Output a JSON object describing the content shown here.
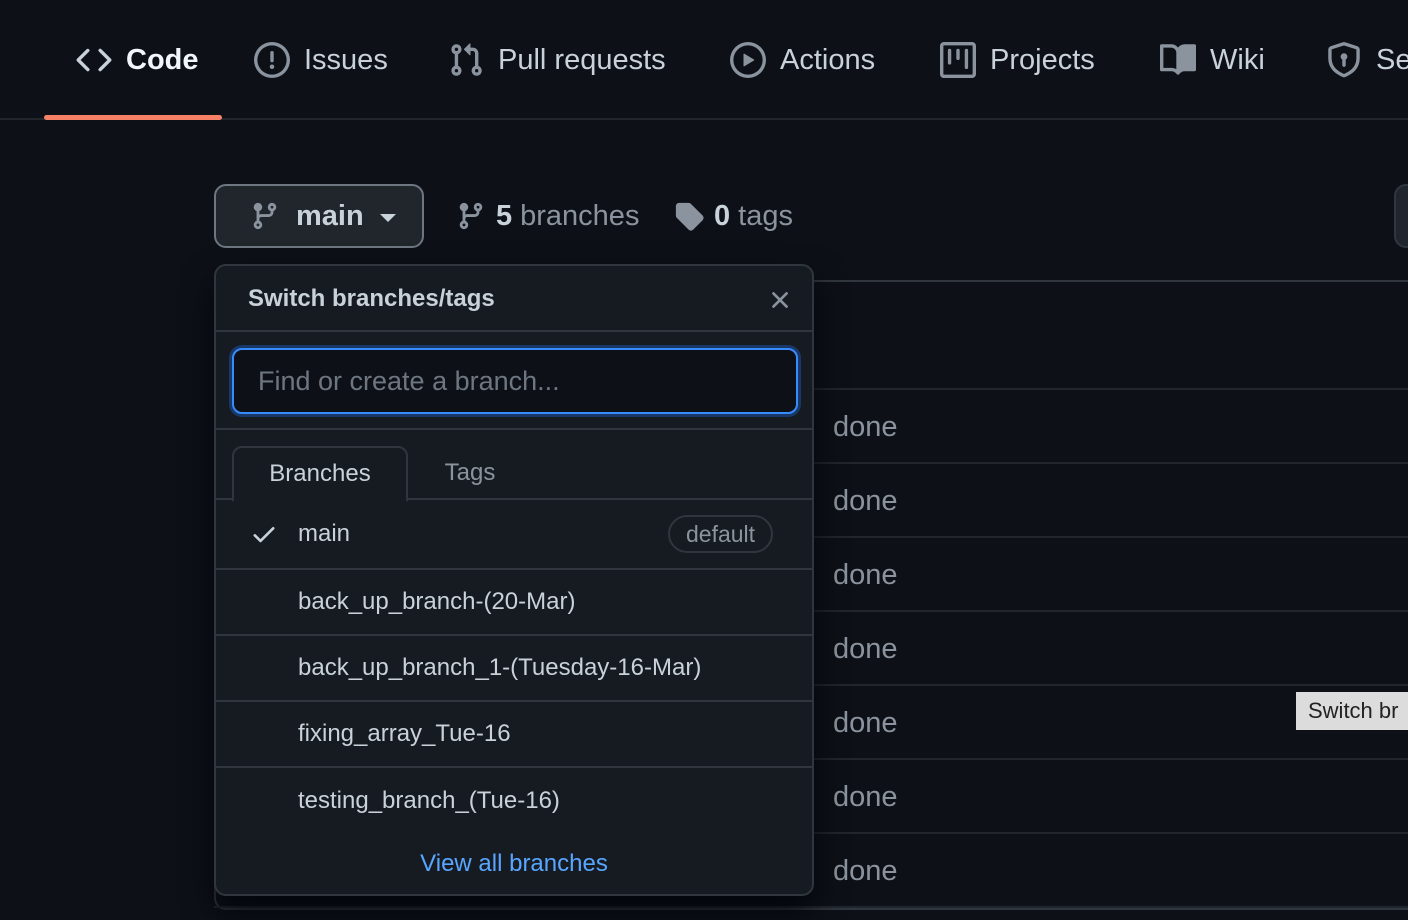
{
  "nav": {
    "tabs": [
      {
        "label": "Code",
        "icon": "code-icon",
        "active": true
      },
      {
        "label": "Issues",
        "icon": "issue-opened-icon"
      },
      {
        "label": "Pull requests",
        "icon": "git-pull-request-icon"
      },
      {
        "label": "Actions",
        "icon": "play-icon"
      },
      {
        "label": "Projects",
        "icon": "project-icon"
      },
      {
        "label": "Wiki",
        "icon": "book-icon"
      },
      {
        "label": "Se",
        "icon": "shield-icon"
      }
    ]
  },
  "branch_bar": {
    "current_branch": "main",
    "branches_count": "5",
    "branches_label": "branches",
    "tags_count": "0",
    "tags_label": "tags"
  },
  "dropdown": {
    "title": "Switch branches/tags",
    "filter_placeholder": "Find or create a branch...",
    "tabs": [
      "Branches",
      "Tags"
    ],
    "branches": [
      {
        "name": "main",
        "selected": true,
        "badge": "default"
      },
      {
        "name": "back_up_branch-(20-Mar)"
      },
      {
        "name": "back_up_branch_1-(Tuesday-16-Mar)"
      },
      {
        "name": "fixing_array_Tue-16"
      },
      {
        "name": "testing_branch_(Tue-16)"
      }
    ],
    "view_all": "View all branches"
  },
  "file_list": {
    "commit_messages": [
      "done",
      "done",
      "done",
      "done",
      "done",
      "done",
      "done"
    ]
  },
  "tooltip": "Switch br",
  "colors": {
    "background": "#0d1117",
    "active_underline": "#f78166",
    "focus_border": "#388bfd",
    "link": "#58a6ff"
  }
}
